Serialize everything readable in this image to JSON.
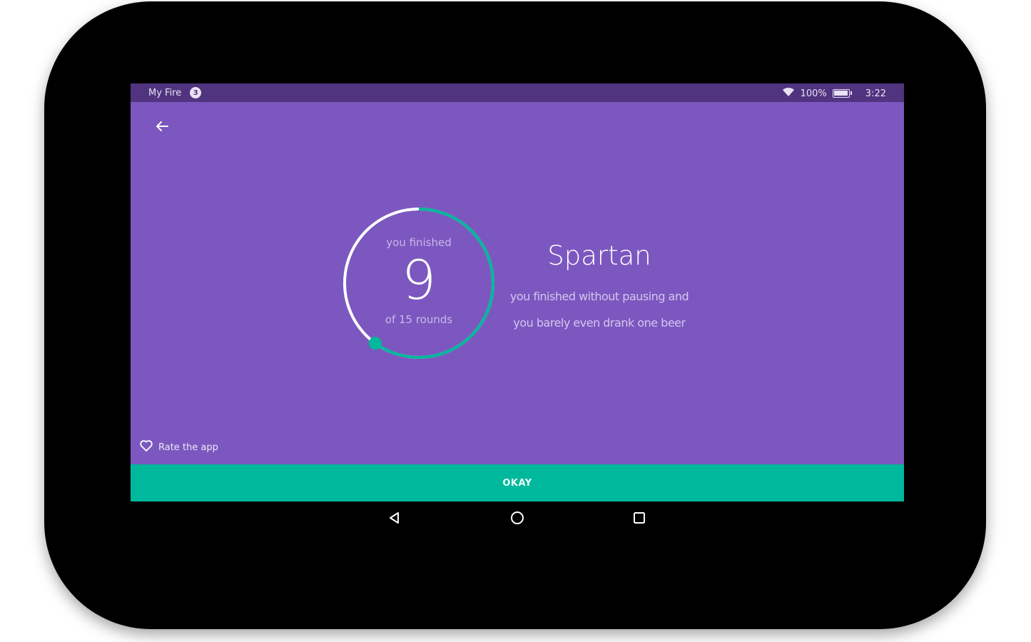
{
  "status_bar": {
    "app_name": "My Fire",
    "notification_count": "3",
    "battery_percent_label": "100%",
    "battery_level": 1.0,
    "time": "3:22"
  },
  "result": {
    "ring_top_label": "you finished",
    "rounds_finished": "9",
    "ring_bottom_label": "of 15 rounds",
    "progress_fraction": 0.6,
    "title": "Spartan",
    "description_line1": "you finished without pausing and",
    "description_line2": "you barely even drank one beer"
  },
  "rate_app_label": "Rate the app",
  "okay_label": "OKAY",
  "icons": {
    "back": "arrow-left-icon",
    "rate": "heart-outline-icon",
    "wifi": "wifi-icon",
    "battery": "battery-icon",
    "nav_back": "triangle-back-icon",
    "nav_home": "circle-home-icon",
    "nav_recents": "square-recents-icon"
  },
  "colors": {
    "background": "#7b57bf",
    "status_bar": "#50347f",
    "accent": "#00b89b",
    "ring_track": "#ffffff"
  }
}
